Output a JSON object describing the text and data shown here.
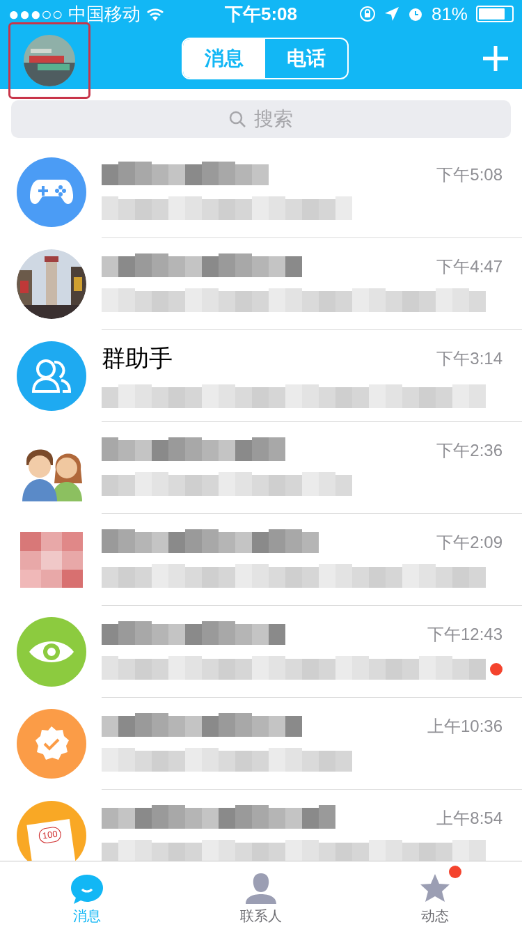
{
  "status_bar": {
    "carrier": "●●●○○ 中国移动",
    "time": "下午5:08",
    "battery": "81%"
  },
  "header": {
    "tabs": [
      {
        "label": "消息",
        "selected": true
      },
      {
        "label": "电话",
        "selected": false
      }
    ],
    "highlight_avatar": true
  },
  "search": {
    "placeholder": "搜索"
  },
  "conversations": [
    {
      "avatar": {
        "kind": "gamepad"
      },
      "time": "下午5:08",
      "unread": false
    },
    {
      "time": "下午4:47",
      "unread": false
    },
    {
      "avatar": {
        "kind": "group"
      },
      "name": "群助手",
      "time": "下午3:14",
      "unread": false
    },
    {
      "avatar": {
        "kind": "couple"
      },
      "time": "下午2:36",
      "unread": false
    },
    {
      "avatar": {
        "kind": "pixelated"
      },
      "time": "下午2:09",
      "unread": false
    },
    {
      "avatar": {
        "kind": "eye"
      },
      "time": "下午12:43",
      "unread": true
    },
    {
      "avatar": {
        "kind": "badge"
      },
      "time": "上午10:36",
      "unread": false
    },
    {
      "avatar": {
        "kind": "memo",
        "label": "100"
      },
      "time": "上午8:54",
      "unread": false
    }
  ],
  "tab_bar": [
    {
      "label": "消息",
      "kind": "chat",
      "selected": true,
      "badge": false
    },
    {
      "label": "联系人",
      "kind": "contact",
      "selected": false,
      "badge": false
    },
    {
      "label": "动态",
      "kind": "star",
      "selected": false,
      "badge": true
    }
  ]
}
